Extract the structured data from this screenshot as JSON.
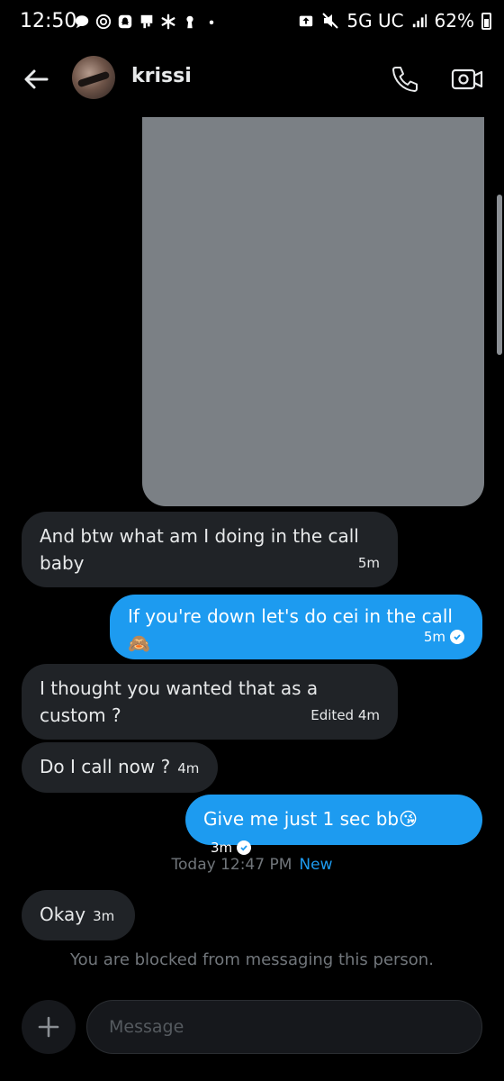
{
  "status_bar": {
    "time": "12:50",
    "network": "5G UC",
    "battery": "62%"
  },
  "header": {
    "contact_name": "krissi"
  },
  "messages": [
    {
      "line1": "And btw what am I doing in the call",
      "line2": "baby",
      "time": "5m"
    },
    {
      "text": "If you're down let's do cei in the call🙈",
      "time": "5m"
    },
    {
      "line1": "I thought you wanted that as a",
      "line2": "custom ?",
      "time": "Edited 4m"
    },
    {
      "text": "Do I call now ?",
      "time": "4m"
    },
    {
      "text": "Give me just 1 sec bb😘",
      "time": "3m"
    },
    {
      "text": "Okay",
      "time": "3m"
    }
  ],
  "day_separator": {
    "label": "Today 12:47 PM",
    "new_label": "New"
  },
  "blocked_notice": "You are blocked from messaging this person.",
  "composer": {
    "placeholder": "Message"
  },
  "colors": {
    "accent": "#1d9bf0",
    "received_bubble": "#202327",
    "background": "#000000"
  }
}
